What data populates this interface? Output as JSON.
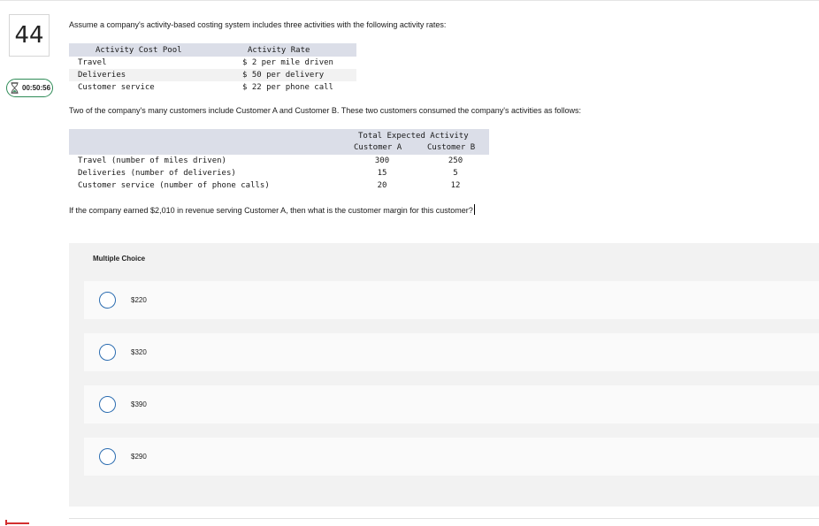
{
  "question": {
    "number": "44",
    "timer": "00:50:56",
    "intro": "Assume a company's activity-based costing system includes three activities with the following activity rates:",
    "rates_table": {
      "headers": [
        "Activity Cost Pool",
        "Activity Rate"
      ],
      "rows": [
        [
          "Travel",
          "$ 2 per mile driven"
        ],
        [
          "Deliveries",
          "$ 50 per delivery"
        ],
        [
          "Customer service",
          "$ 22 per phone call"
        ]
      ]
    },
    "middle": "Two of the company's many customers include Customer A and Customer B. These two customers consumed the company's activities as follows:",
    "activity_table": {
      "group_header": "Total Expected Activity",
      "col_a": "Customer A",
      "col_b": "Customer B",
      "rows": [
        [
          "Travel (number of miles driven)",
          "300",
          "250"
        ],
        [
          "Deliveries (number of deliveries)",
          "15",
          "5"
        ],
        [
          "Customer service (number of phone calls)",
          "20",
          "12"
        ]
      ]
    },
    "prompt": "If the company earned $2,010 in revenue serving Customer A, then what is the customer margin for this customer?"
  },
  "multiple_choice": {
    "title": "Multiple Choice",
    "options": [
      "$220",
      "$320",
      "$390",
      "$290"
    ]
  },
  "colors": {
    "table_header": "#dbdee8",
    "radio_border": "#2b6cb0",
    "timer_border": "#2e8b57",
    "accent_red": "#d32f2f"
  }
}
